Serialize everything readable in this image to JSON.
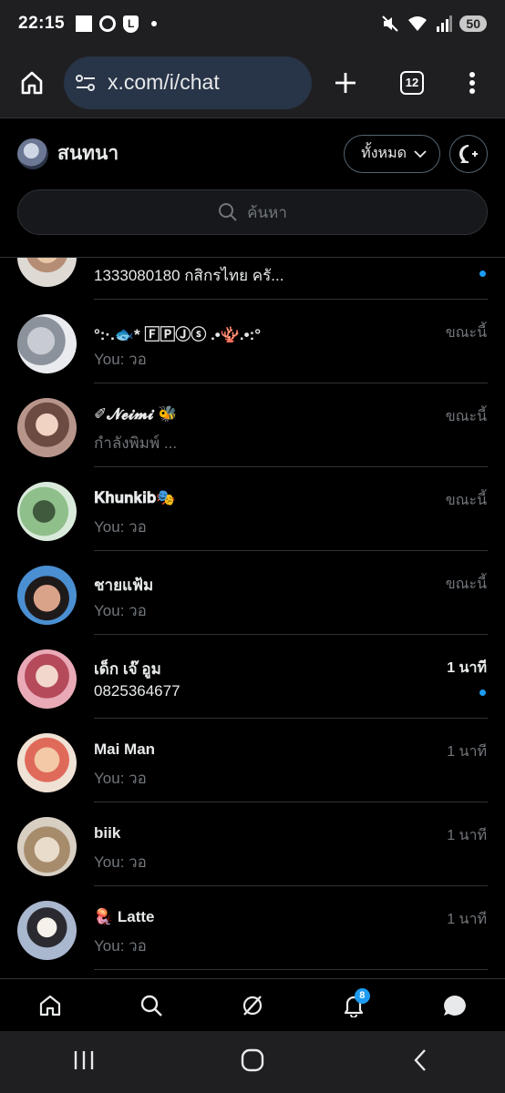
{
  "status_bar": {
    "time": "22:15",
    "battery": "50",
    "shield_icon_glyph": "L"
  },
  "browser": {
    "url": "x.com/i/chat",
    "tab_count": "12"
  },
  "header": {
    "title": "สนทนา",
    "filter_label": "ทั้งหมด"
  },
  "search": {
    "placeholder": "ค้นหา"
  },
  "conversations": [
    {
      "name": "",
      "preview": "1333080180 กสิกรไทย ครั...",
      "time": "",
      "unread": true
    },
    {
      "name": "°:·.🐟* 🄵🄿Ⓙⓢ .•🪸.•:°",
      "preview": "You: วอ",
      "time": "ขณะนี้",
      "unread": false
    },
    {
      "name": "✐𝓝𝓮𝓲𝓶𝓲       🐝",
      "preview": "กำลังพิมพ์ ...",
      "time": "ขณะนี้",
      "unread": false
    },
    {
      "name": "𝐊𝐡𝐮𝐧𝐤𝐢𝐛🎭",
      "preview": "You: วอ",
      "time": "ขณะนี้",
      "unread": false
    },
    {
      "name": "ชายแฟ้ม",
      "preview": "You: วอ",
      "time": "ขณะนี้",
      "unread": false
    },
    {
      "name": "เด็ก เจ๊ อูม",
      "preview": "0825364677",
      "time": "1 นาที",
      "unread": true
    },
    {
      "name": "Mai Man",
      "preview": "You: วอ",
      "time": "1 นาที",
      "unread": false
    },
    {
      "name": "biik",
      "preview": "You: วอ",
      "time": "1 นาที",
      "unread": false
    },
    {
      "name": "🪼 Latte",
      "preview": "You: วอ",
      "time": "1 นาที",
      "unread": false
    }
  ],
  "bottom_nav": {
    "items": [
      "home-icon",
      "search-icon",
      "grok-icon",
      "bell-icon",
      "chat-icon"
    ],
    "notifications_badge": "8"
  },
  "colors": {
    "accent": "#1d9bf0",
    "background": "#000000",
    "muted_text": "#71767b",
    "url_box": "#283447"
  }
}
